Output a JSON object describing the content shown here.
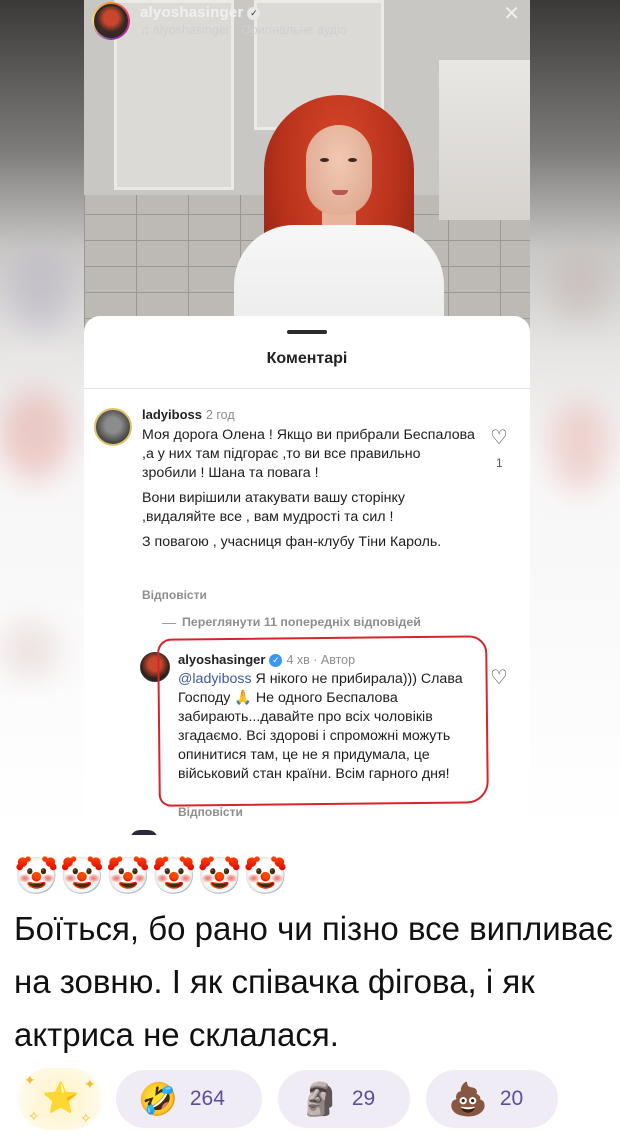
{
  "video": {
    "username": "alyoshasinger",
    "audio_label": "♫ alyoshasinger · Оригінальне аудіо"
  },
  "sheet": {
    "title": "Коментарі"
  },
  "comment1": {
    "user": "ladyiboss",
    "time": "2 год",
    "paragraphs": [
      "Моя дорога Олена ! Якщо ви прибрали Беспалова ,а у них там підгорає ,то ви все правильно зробили ! Шана та повага !",
      "Вони вирішили атакувати вашу сторінку ,видаляйте все , вам мудрості та сил !",
      "З повагою , учасниця фан-клубу Тіни Кароль."
    ],
    "reply_label": "Відповісти",
    "likes": "1"
  },
  "view_more": "Переглянути 11 попередніх відповідей",
  "comment2": {
    "user": "alyoshasinger",
    "time": "4 хв",
    "author_tag": "Автор",
    "mention": "@ladyiboss",
    "text_after_mention": " Я нікого не прибирала))) Слава Господу 🙏 Не одного Беспалова забирають...давайте про всіх чоловіків згадаємо. Всі здорові і спроможні можуть опинитися там, це не я придумала, це військовий стан країни. Всім гарного дня!",
    "reply_label": "Відповісти"
  },
  "post": {
    "clown_emojis": "🤡🤡🤡🤡🤡🤡",
    "text": "Боїться, бо рано чи пізно все випливає на зовню. І як співачка фігова, і як актриса не склалася."
  },
  "reactions": {
    "add": "⭐",
    "items": [
      {
        "emoji": "🤣",
        "count": "264"
      },
      {
        "emoji": "🗿",
        "count": "29"
      },
      {
        "emoji": "💩",
        "count": "20"
      }
    ]
  },
  "colors": {
    "highlight_box": "#d8232a",
    "mention": "#3c5a99",
    "reaction_pill": "#efecf6",
    "reaction_count": "#5b4f9a"
  }
}
